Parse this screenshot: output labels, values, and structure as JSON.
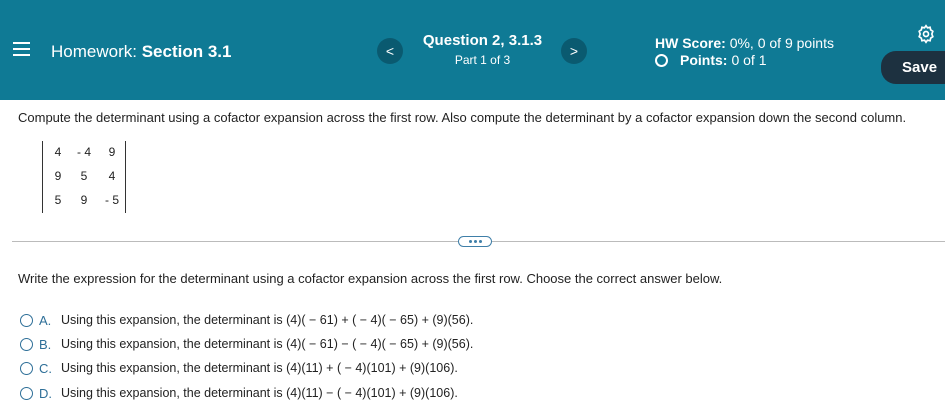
{
  "header": {
    "hw_label": "Homework:",
    "hw_section": "Section 3.1",
    "prev_glyph": "<",
    "next_glyph": ">",
    "question_title": "Question 2, 3.1.3",
    "question_part": "Part 1 of 3",
    "score_label": "HW Score:",
    "score_value": "0%, 0 of 9 points",
    "points_label": "Points:",
    "points_value": "0 of 1",
    "save_label": "Save",
    "gear_icon": "gear-icon"
  },
  "problem": {
    "prompt": "Compute the determinant using a cofactor expansion across the first row. Also compute the determinant by a cofactor expansion down the second column.",
    "matrix": [
      [
        "4",
        "- 4",
        "9"
      ],
      [
        "9",
        "5",
        "4"
      ],
      [
        "5",
        "9",
        "- 5"
      ]
    ]
  },
  "part": {
    "instruction": "Write the expression for the determinant using a cofactor expansion across the first row. Choose the correct answer below.",
    "options": [
      {
        "letter": "A.",
        "text": "Using this expansion, the determinant is (4)( − 61) + ( − 4)( − 65) + (9)(56)."
      },
      {
        "letter": "B.",
        "text": "Using this expansion, the determinant is (4)( − 61) − ( − 4)( − 65) + (9)(56)."
      },
      {
        "letter": "C.",
        "text": "Using this expansion, the determinant is (4)(11) + ( − 4)(101) + (9)(106)."
      },
      {
        "letter": "D.",
        "text": "Using this expansion, the determinant is (4)(11) − ( − 4)(101) + (9)(106)."
      }
    ]
  },
  "colors": {
    "header_bg": "#0f7a95",
    "save_bg": "#1d3140",
    "accent": "#2e6f98"
  }
}
